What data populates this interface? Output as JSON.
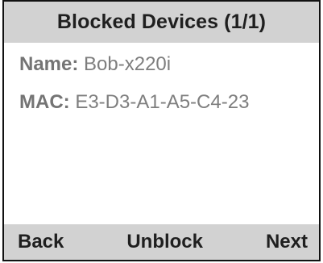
{
  "header": {
    "title": "Blocked Devices (1/1)"
  },
  "device": {
    "name_label": "Name:",
    "name_value": "Bob-x220i",
    "mac_label": "MAC:",
    "mac_value": "E3-D3-A1-A5-C4-23"
  },
  "softkeys": {
    "back": "Back",
    "unblock": "Unblock",
    "next": "Next"
  },
  "colors": {
    "bar_background": "#d2d2d2",
    "bar_text": "#1f1f1f",
    "body_text": "#7a7a7a",
    "border": "#111111"
  }
}
